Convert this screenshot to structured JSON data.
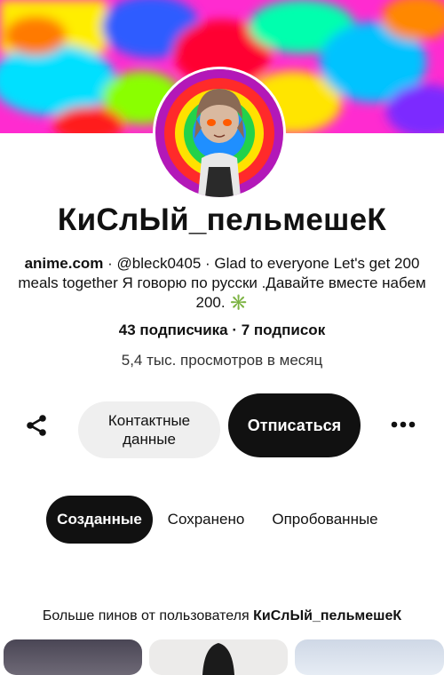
{
  "profile": {
    "display_name": "КиСлЫй_пельмешеК",
    "website": "anime.com",
    "bio": "· @bleck0405 · Glad to everyone  Let's get 200 meals together Я говорю  по русски .Давайте вместе набем 200. ✳️",
    "stats": "43 подписчика · 7 подписок",
    "monthly_views": "5,4 тыс. просмотров в месяц"
  },
  "actions": {
    "share_icon": "share-icon",
    "contact_label": "Контактные данные",
    "unfollow_label": "Отписаться",
    "more_icon": "more-dots-icon"
  },
  "tabs": [
    {
      "label": "Созданные",
      "selected": true
    },
    {
      "label": "Сохранено",
      "selected": false
    },
    {
      "label": "Опробованные",
      "selected": false
    }
  ],
  "more_pins": {
    "prefix": "Больше пинов от пользователя",
    "username": "КиСлЫй_пельмешеК"
  },
  "colors": {
    "primary_button": "#111111",
    "secondary_button": "#efefef",
    "text": "#111111"
  }
}
